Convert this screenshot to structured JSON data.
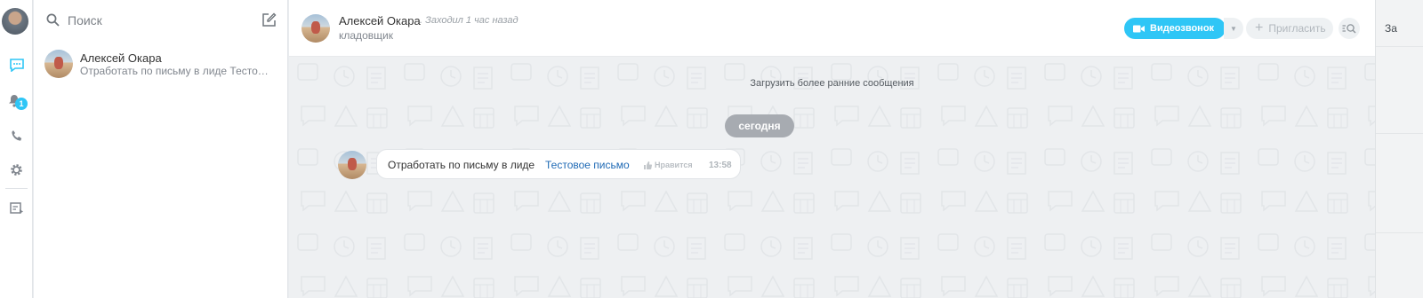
{
  "search": {
    "placeholder": "Поиск"
  },
  "rail": {
    "notifications_count": "1"
  },
  "recent": [
    {
      "name": "Алексей Окара",
      "preview": "Отработать по письму в лиде  Тестовое письмо"
    }
  ],
  "header": {
    "name": "Алексей Окара",
    "status": ". Заходил 1 час назад",
    "position": "кладовщик",
    "video_call_label": "Видеозвонок",
    "invite_label": "Пригласить"
  },
  "body": {
    "load_earlier": "Загрузить более ранние сообщения",
    "date_separator": "сегодня"
  },
  "messages": [
    {
      "text": "Отработать по письму в лиде",
      "link": "Тестовое письмо",
      "like_label": "Нравится",
      "time": "13:58"
    }
  ],
  "edge": {
    "text": "За"
  },
  "colors": {
    "accent": "#2fc6f6",
    "link": "#1f6ab5",
    "date_pill": "#a7abb1"
  }
}
